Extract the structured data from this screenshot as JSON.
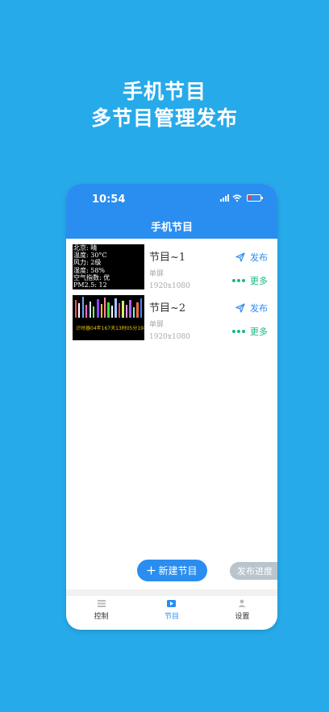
{
  "promo": {
    "line1": "手机节目",
    "line2": "多节目管理发布"
  },
  "status": {
    "time": "10:54"
  },
  "nav": {
    "title": "手机节目"
  },
  "programs": [
    {
      "title": "节目~1",
      "type": "单屏",
      "resolution": "1920x1080",
      "publish_label": "发布",
      "more_label": "更多",
      "thumb_lines": [
        "北京: 晴",
        "温度: 30°C",
        "风力: 2级",
        "湿度: 58%",
        "空气指数: 优",
        "PM2.5: 12"
      ]
    },
    {
      "title": "节目~2",
      "type": "单屏",
      "resolution": "1920x1080",
      "publish_label": "发布",
      "more_label": "更多",
      "thumb_counter": "计时器04年167天13时05分19秒"
    }
  ],
  "actions": {
    "new_program": "新建节目",
    "progress": "发布进度"
  },
  "tabbar": {
    "items": [
      {
        "label": "控制"
      },
      {
        "label": "节目"
      },
      {
        "label": "设置"
      }
    ]
  },
  "colors": {
    "accent": "#2a8df0",
    "background": "#26aaea",
    "more_green": "#19b87a"
  }
}
